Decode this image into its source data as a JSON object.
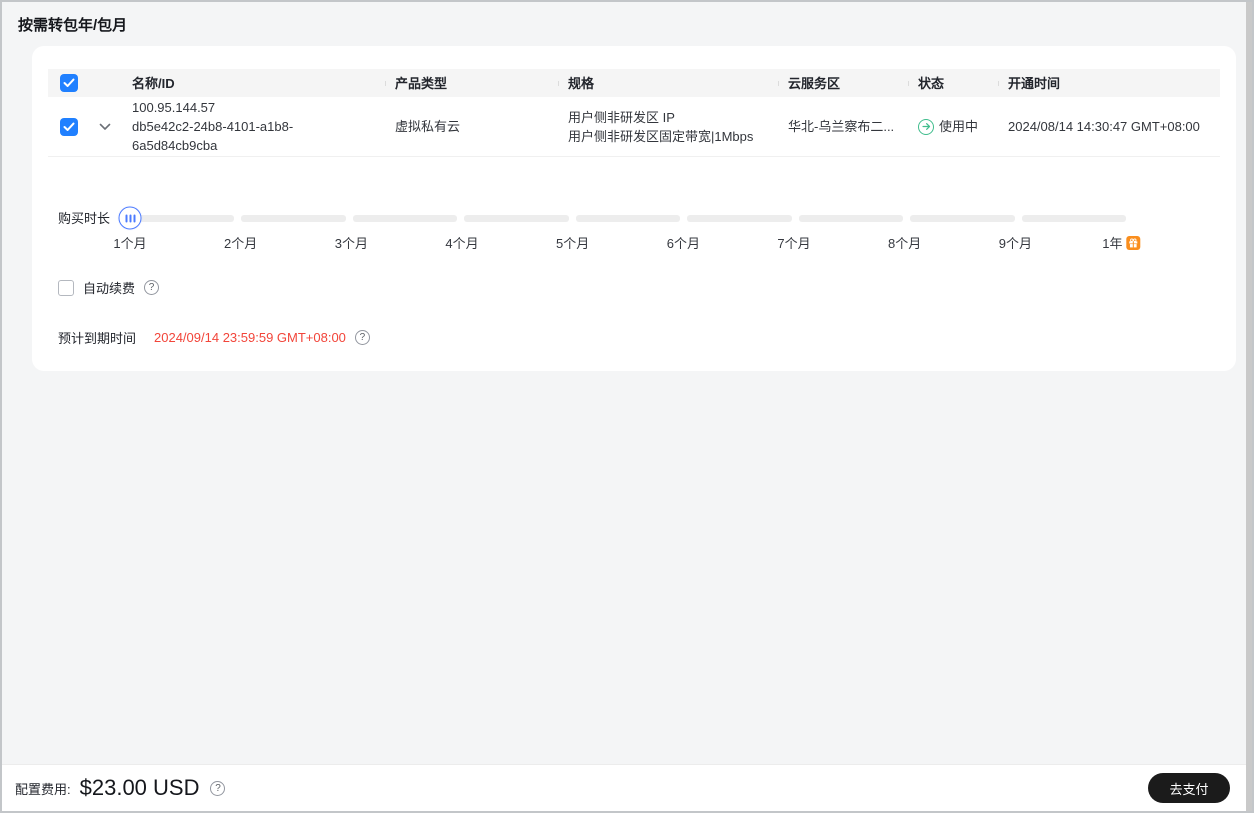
{
  "page": {
    "title": "按需转包年/包月"
  },
  "table": {
    "columns": [
      "名称/ID",
      "产品类型",
      "规格",
      "云服务区",
      "状态",
      "开通时间"
    ],
    "row": {
      "name": "100.95.144.57",
      "id": "db5e42c2-24b8-4101-a1b8-6a5d84cb9cba",
      "product_type": "虚拟私有云",
      "spec_line1": "用户侧非研发区 IP",
      "spec_line2": "用户侧非研发区固定带宽|1Mbps",
      "region": "华北-乌兰察布二...",
      "status": "使用中",
      "open_time": "2024/08/14 14:30:47 GMT+08:00",
      "selected": true
    }
  },
  "duration": {
    "label": "购买时长",
    "ticks": [
      "1个月",
      "2个月",
      "3个月",
      "4个月",
      "5个月",
      "6个月",
      "7个月",
      "8个月",
      "9个月",
      "1年"
    ],
    "selected": "1个月"
  },
  "auto_renew": {
    "label": "自动续费",
    "checked": false
  },
  "expiry": {
    "label": "预计到期时间",
    "value": "2024/09/14 23:59:59 GMT+08:00"
  },
  "footer": {
    "fee_label": "配置费用:",
    "fee_value": "$23.00 USD",
    "pay_button": "去支付"
  },
  "icons": {
    "help_glyph": "?",
    "status_icon": "arrow-right-circle",
    "gift_icon": "gift",
    "checkbox_icon": "checkmark",
    "expand_icon": "chevron-down"
  },
  "colors": {
    "accent_blue": "#2080ff",
    "slider_blue": "#4c7bff",
    "status_green": "#41bd8d",
    "expiry_red": "#f2453a",
    "promo_orange": "#fa8e1d",
    "button_black": "#1b1b1b"
  }
}
